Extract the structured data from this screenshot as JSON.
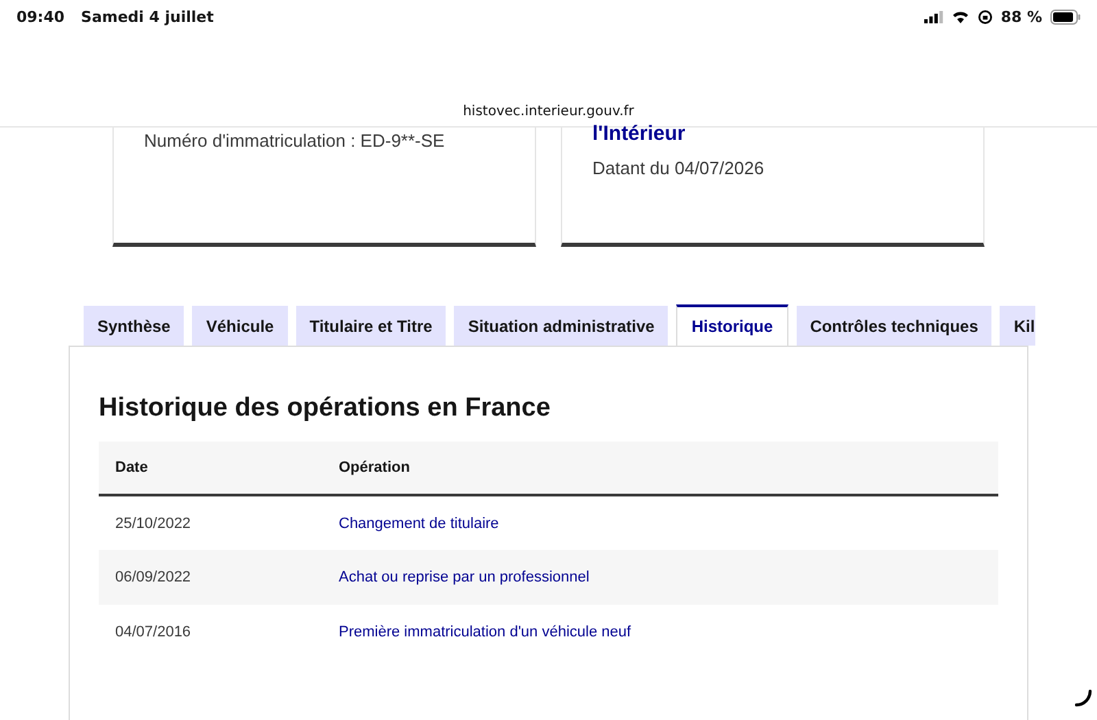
{
  "status_bar": {
    "time": "09:40",
    "date": "Samedi 4 juillet",
    "battery": "88 %"
  },
  "address_bar": {
    "url": "histovec.interieur.gouv.fr"
  },
  "cards": [
    {
      "lines": [
        {
          "kind": "text",
          "text": "Numéro d'immatriculation : ED-9**-SE"
        }
      ]
    },
    {
      "lines": [
        {
          "kind": "title",
          "text": "l'Intérieur"
        },
        {
          "kind": "text",
          "text": "Datant du 04/07/2026"
        }
      ]
    }
  ],
  "tabs": [
    {
      "label": "Synthèse",
      "selected": false
    },
    {
      "label": "Véhicule",
      "selected": false
    },
    {
      "label": "Titulaire et Titre",
      "selected": false
    },
    {
      "label": "Situation administrative",
      "selected": false
    },
    {
      "label": "Historique",
      "selected": true
    },
    {
      "label": "Contrôles techniques",
      "selected": false
    },
    {
      "label": "Kil",
      "selected": false
    }
  ],
  "panel": {
    "heading": "Historique des opérations en France",
    "table": {
      "columns": [
        "Date",
        "Opération"
      ],
      "rows": [
        {
          "date": "25/10/2022",
          "operation": "Changement de titulaire"
        },
        {
          "date": "06/09/2022",
          "operation": "Achat ou reprise par un professionnel"
        },
        {
          "date": "04/07/2016",
          "operation": "Première immatriculation d'un véhicule neuf"
        }
      ]
    }
  }
}
